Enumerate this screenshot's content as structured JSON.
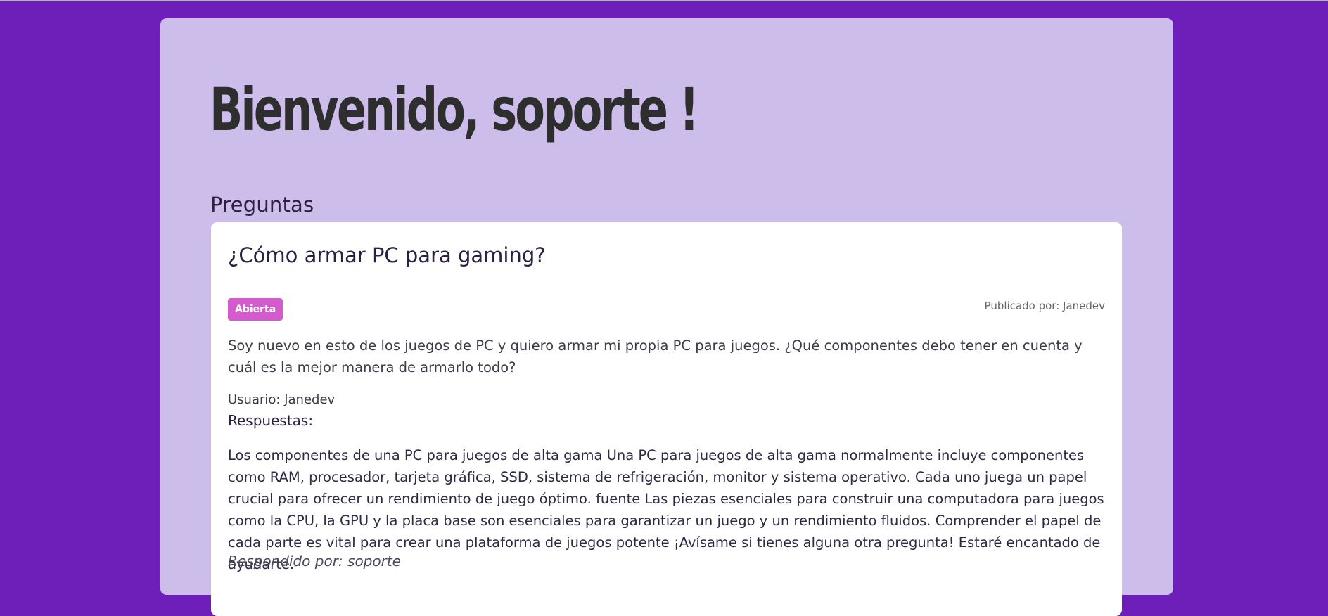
{
  "header": {
    "welcome": "Bienvenido, soporte !"
  },
  "section": {
    "title": "Preguntas"
  },
  "question": {
    "title": "¿Cómo armar PC para gaming?",
    "status": "Abierta",
    "posted_by": "Publicado por: Janedev",
    "body": "Soy nuevo en esto de los juegos de PC y quiero armar mi propia PC para juegos. ¿Qué componentes debo tener en cuenta y cuál es la mejor manera de armarlo todo?",
    "user": "Usuario: Janedev",
    "answers_label": "Respuestas:",
    "answers": [
      {
        "text": "Los componentes de una PC para juegos de alta gama Una PC para juegos de alta gama normalmente incluye componentes como RAM, procesador, tarjeta gráfica, SSD, sistema de refrigeración, monitor y sistema operativo. Cada uno juega un papel crucial para ofrecer un rendimiento de juego óptimo. fuente Las piezas esenciales para construir una computadora para juegos como la CPU, la GPU y la placa base son esenciales para garantizar un juego y un rendimiento fluidos. Comprender el papel de cada parte es vital para crear una plataforma de juegos potente ¡Avísame si tienes alguna otra pregunta! Estaré encantado de ayudarte.",
        "answered_by": "Respondido por: soporte"
      }
    ]
  },
  "colors": {
    "background": "#6f1fb9",
    "panel": "#cdbdeb",
    "card": "#ffffff",
    "badge": "#d35bcb"
  }
}
